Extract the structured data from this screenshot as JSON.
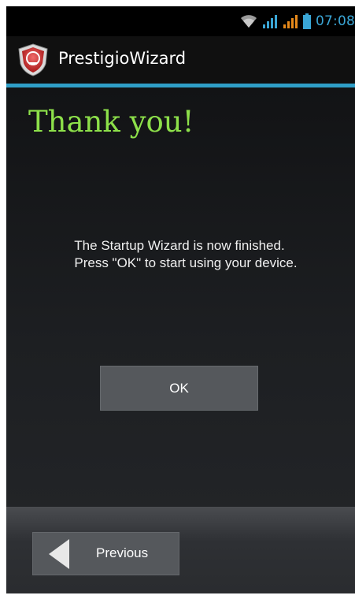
{
  "status_bar": {
    "time": "07:08",
    "icons": [
      "wifi-icon",
      "signal-icon",
      "signal-icon",
      "battery-icon"
    ],
    "accent_color": "#3aa6d6"
  },
  "action_bar": {
    "title": "PrestigioWizard",
    "logo_icon": "prestigio-logo-icon",
    "divider_color": "#2f9fc8"
  },
  "main": {
    "heading": "Thank you!",
    "heading_color": "#8de04a",
    "message_line1": "The Startup Wizard is now finished.",
    "message_line2": "Press \"OK\" to start using your device.",
    "ok_label": "OK"
  },
  "bottom_bar": {
    "previous_label": "Previous",
    "previous_icon": "back-arrow-icon"
  }
}
